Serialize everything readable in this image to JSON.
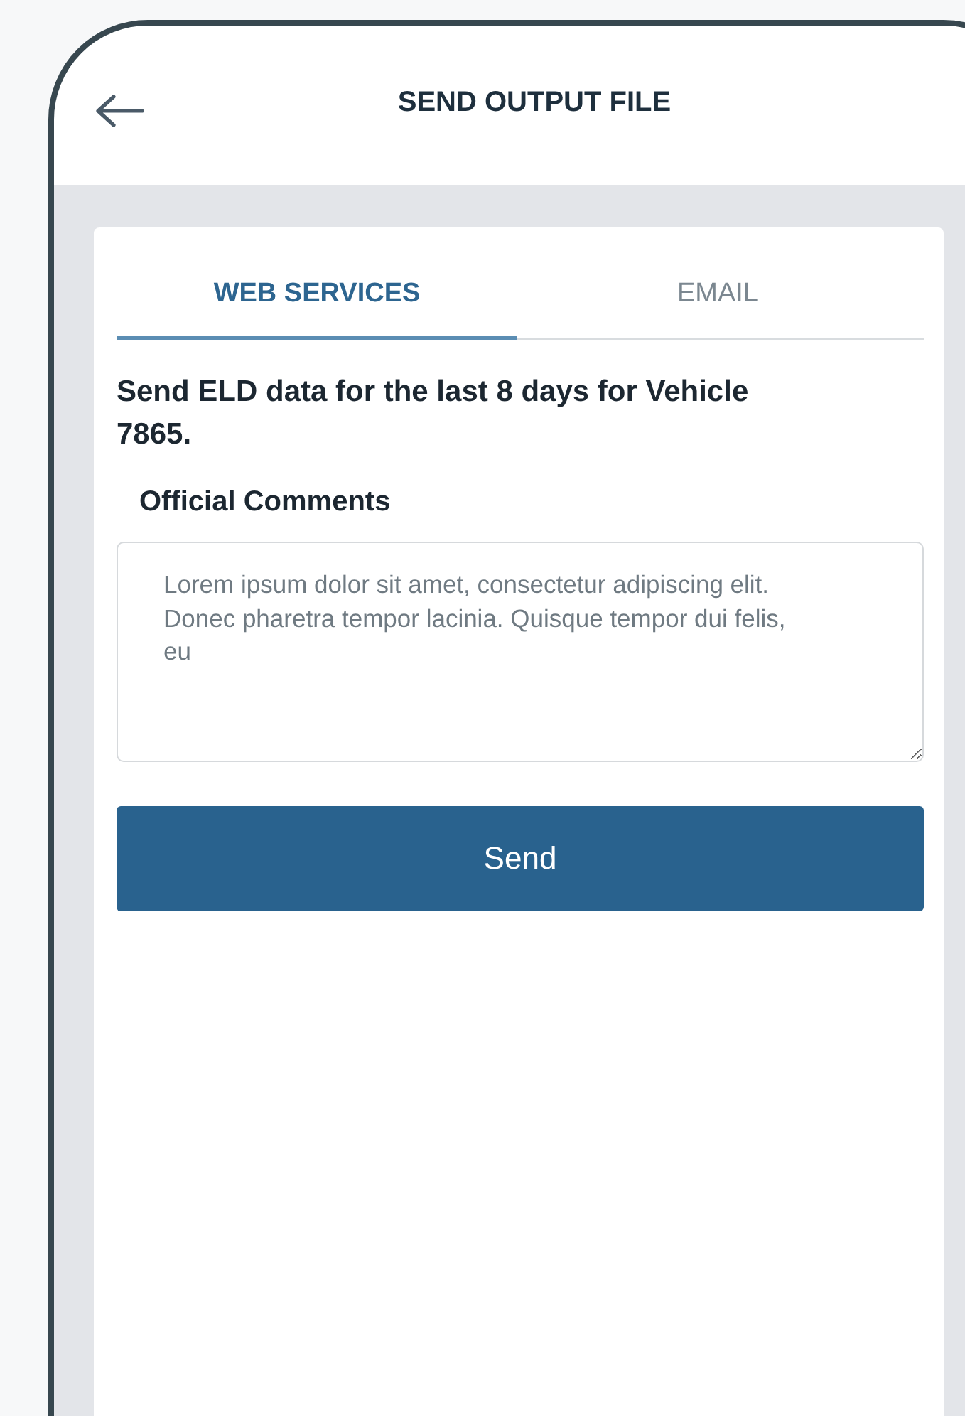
{
  "header": {
    "title": "SEND OUTPUT FILE"
  },
  "tabs": [
    {
      "label": "WEB SERVICES",
      "selected": true
    },
    {
      "label": "EMAIL",
      "selected": false
    }
  ],
  "message": "Send ELD data for the last 8 days for Vehicle 7865.",
  "comments": {
    "label": "Official Comments",
    "placeholder": "Lorem ipsum dolor sit amet, consectetur adipiscing elit. Donec pharetra tempor lacinia. Quisque tempor dui felis, eu"
  },
  "button": "Send"
}
